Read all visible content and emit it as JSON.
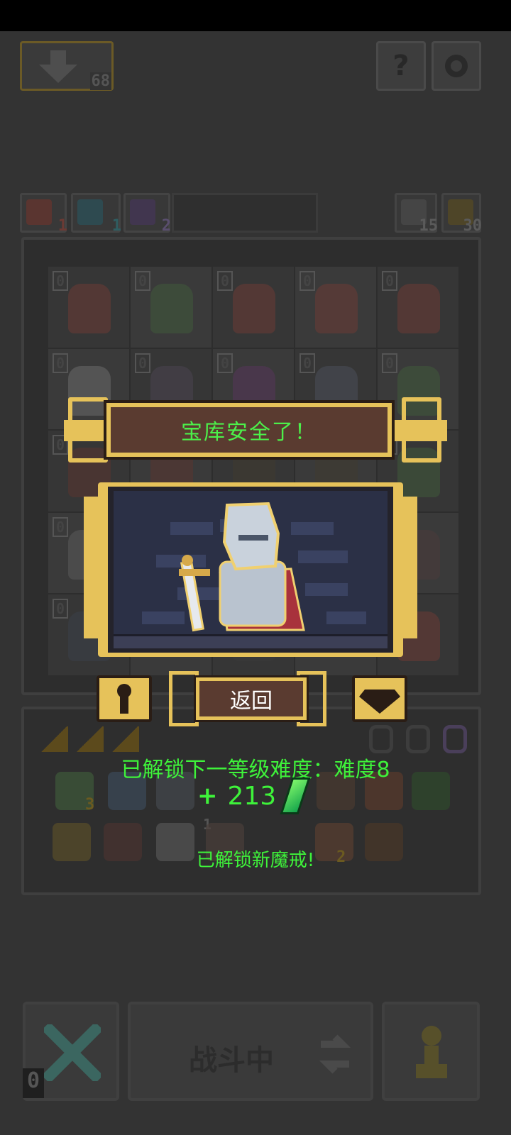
{
  "top_bar": {
    "download_count": "68",
    "help_icon": "question-icon",
    "settings_icon": "gear-icon"
  },
  "stats": {
    "attack": "1",
    "magic": "1",
    "energy": "2",
    "refresh": "15",
    "key": "30"
  },
  "board": {
    "levels": [
      "0",
      "0",
      "0",
      "0",
      "0",
      "0",
      "0",
      "0",
      "0",
      "0",
      "0",
      "0",
      "0",
      "0",
      "0",
      "0",
      "0",
      "0",
      "0",
      "0",
      "0",
      "0",
      "0",
      "0",
      "0"
    ]
  },
  "modal": {
    "title": "宝库安全了！",
    "back_label": "返回",
    "unlock_difficulty": "已解锁下一等级难度：难度8",
    "reward_plus": "+",
    "reward_amount": "213",
    "unlock_ring": "已解锁新魔戒!"
  },
  "inventory": {
    "badge_3": "3",
    "badge_1": "1",
    "badge_2": "2"
  },
  "bottom": {
    "fight_label": "战斗中",
    "cancel_count": "0"
  },
  "colors": {
    "gold": "#e6c25a",
    "plaque": "#5a3b30",
    "green_text": "#3ef23a"
  }
}
